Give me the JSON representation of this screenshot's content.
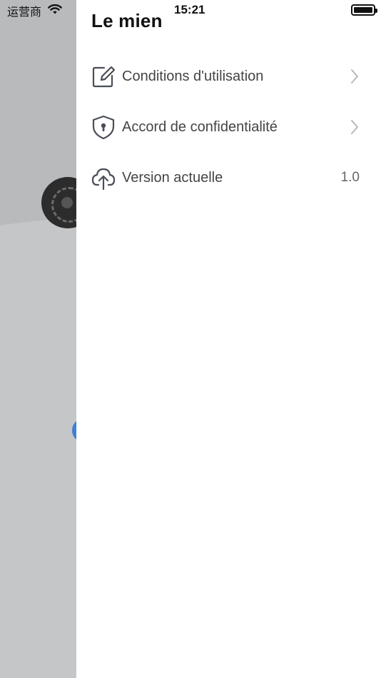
{
  "status_bar": {
    "carrier": "运营商",
    "time": "15:21",
    "wifi_icon": "wifi-icon",
    "battery_icon": "battery-icon"
  },
  "drawer": {
    "title": "Le mien",
    "items": [
      {
        "label": "Conditions d'utilisation",
        "icon": "edit-icon",
        "accessory": "chevron-right-icon"
      },
      {
        "label": "Accord de confidentialité",
        "icon": "shield-lock-icon",
        "accessory": "chevron-right-icon"
      },
      {
        "label": "Version actuelle",
        "icon": "cloud-upload-icon",
        "value": "1.0"
      }
    ]
  },
  "colors": {
    "drawer_bg": "#ffffff",
    "overlay_bg": "#c5c6c8",
    "text_primary": "#111111",
    "text_secondary": "#444444",
    "icon_stroke": "#4a4e57"
  }
}
